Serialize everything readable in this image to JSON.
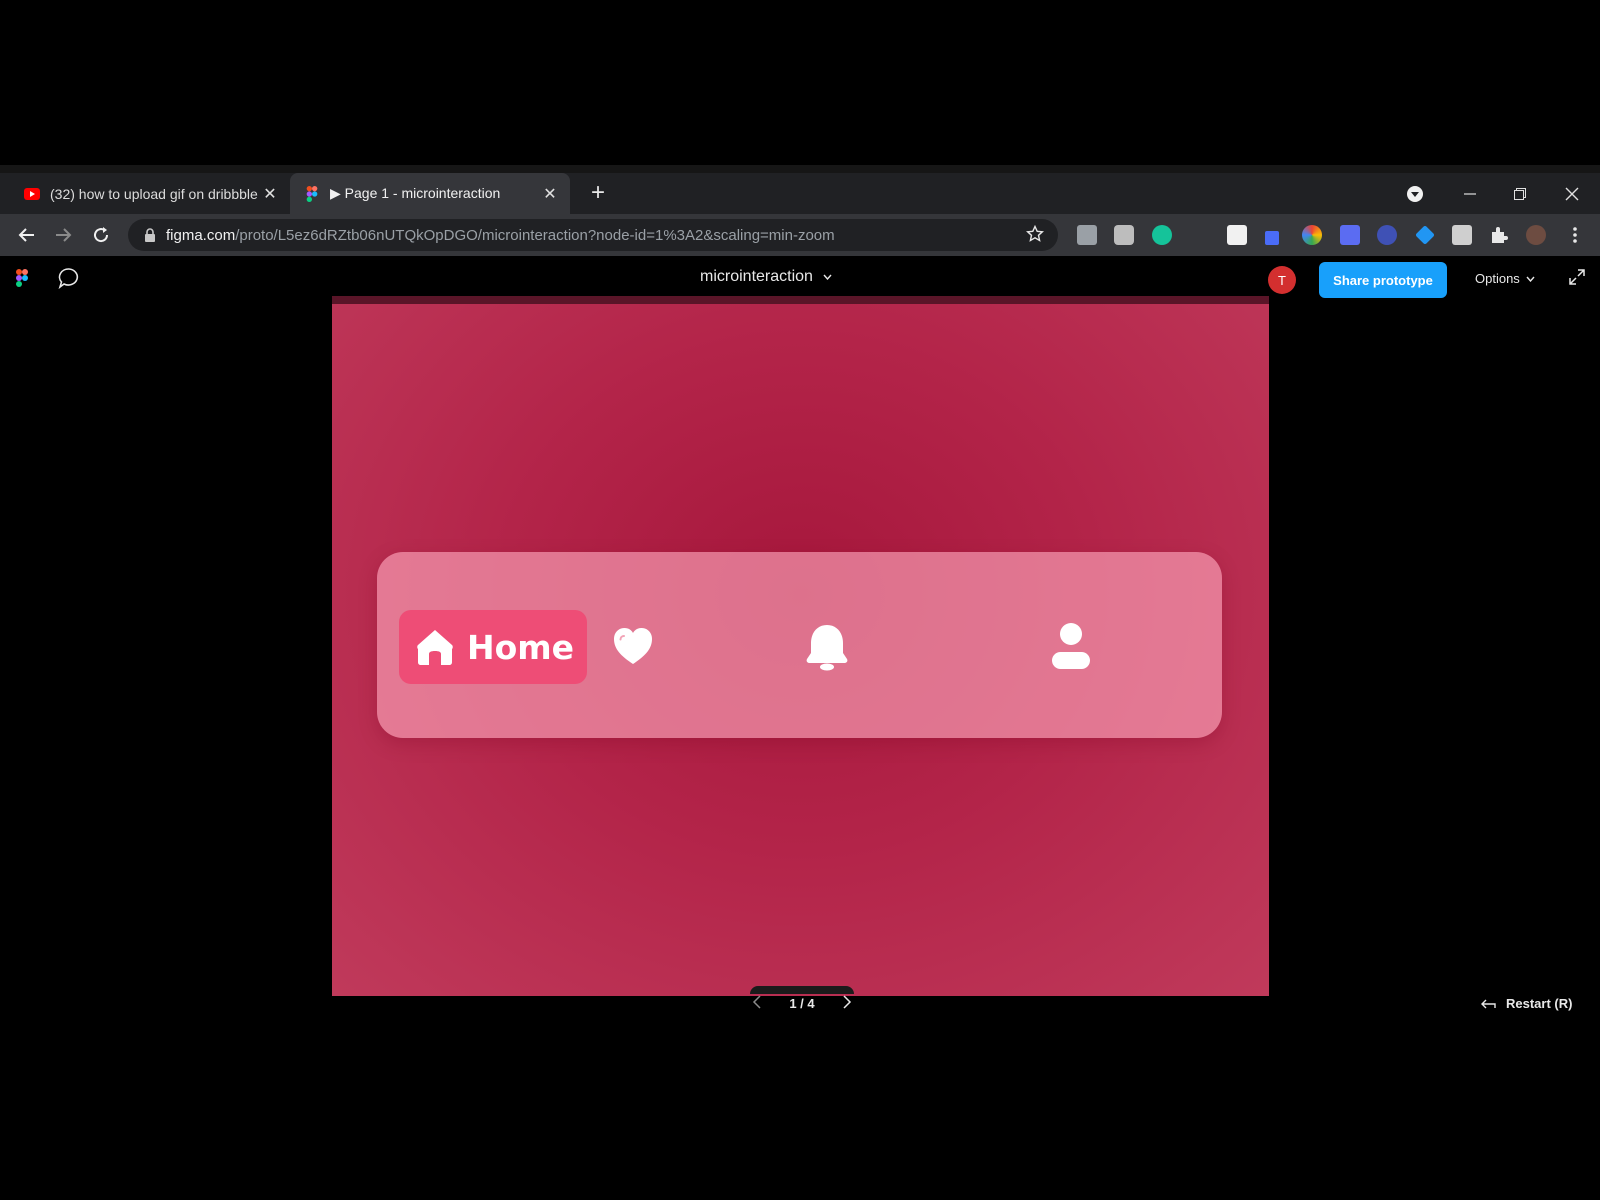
{
  "browser": {
    "tabs": [
      {
        "title": "(32) how to upload gif on dribbble",
        "favicon": "youtube-icon",
        "active": false
      },
      {
        "title": "▶ Page 1 - microinteraction",
        "favicon": "figma-icon",
        "active": true
      }
    ],
    "address": {
      "host": "figma.com",
      "path": "/proto/L5ez6dRZtb06nUTQkOpDGO/microinteraction?node-id=1%3A2&scaling=min-zoom"
    }
  },
  "figma": {
    "project_title": "microinteraction",
    "avatar_initial": "T",
    "share_label": "Share prototype",
    "options_label": "Options"
  },
  "prototype": {
    "nav": {
      "active_label": "Home",
      "items": [
        "home-icon",
        "heart-icon",
        "bell-icon",
        "user-icon"
      ]
    },
    "colors": {
      "frame": "#b32449",
      "nav_bar": "#ef8aa1",
      "active_pill": "#ee4d76",
      "accent": "#18a0fb"
    }
  },
  "footer": {
    "pager": "1 / 4",
    "restart_label": "Restart (R)"
  }
}
